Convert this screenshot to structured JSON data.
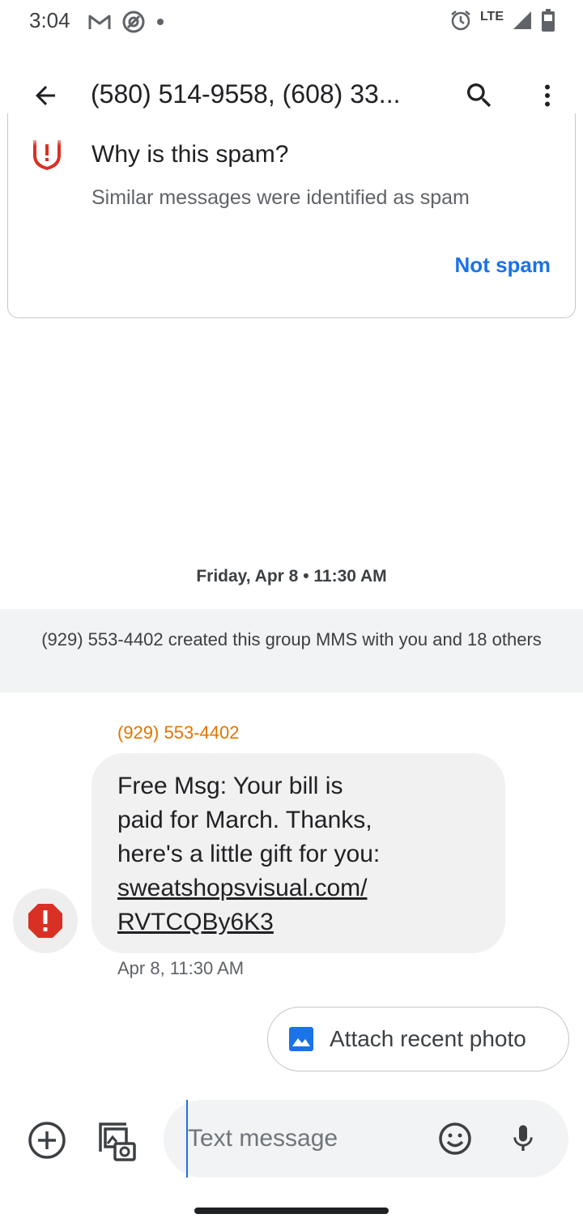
{
  "status_bar": {
    "time": "3:04",
    "left_icons": [
      "gmail-icon",
      "at-sign-icon",
      "dot-icon"
    ],
    "network": "LTE",
    "right_icons": [
      "alarm-icon",
      "signal-icon",
      "battery-icon"
    ]
  },
  "app_bar": {
    "title": "(580) 514-9558, (608) 33...",
    "back_icon": "arrow-back-icon",
    "search_icon": "search-icon",
    "more_icon": "more-vert-icon"
  },
  "spam_card": {
    "title": "Why is this spam?",
    "description": "Similar messages were identified as spam",
    "action_label": "Not spam",
    "icon": "spam-warning-icon",
    "accent_color": "#d93025",
    "action_color": "#1a73e8"
  },
  "conversation": {
    "date_separator": "Friday, Apr 8 • 11:30 AM",
    "group_notice": "(929) 553-4402 created this group MMS with you and 18 others",
    "message": {
      "sender": "(929) 553-4402",
      "sender_color": "#e37400",
      "text_line1": "Free Msg: Your bill is",
      "text_line2": "paid for March. Thanks,",
      "text_line3": "here's a little gift for you:",
      "link_line1": "sweatshopsvisual.com/",
      "link_line2": "RVTCQBy6K3",
      "timestamp": "Apr 8, 11:30 AM",
      "status_icon": "error-icon"
    }
  },
  "suggestion_chip": {
    "label": "Attach recent photo",
    "icon": "image-icon"
  },
  "compose": {
    "placeholder": "Text message",
    "value": "",
    "add_icon": "add-circle-icon",
    "gallery_icon": "gallery-camera-icon",
    "emoji_icon": "emoji-icon",
    "mic_icon": "mic-icon"
  }
}
